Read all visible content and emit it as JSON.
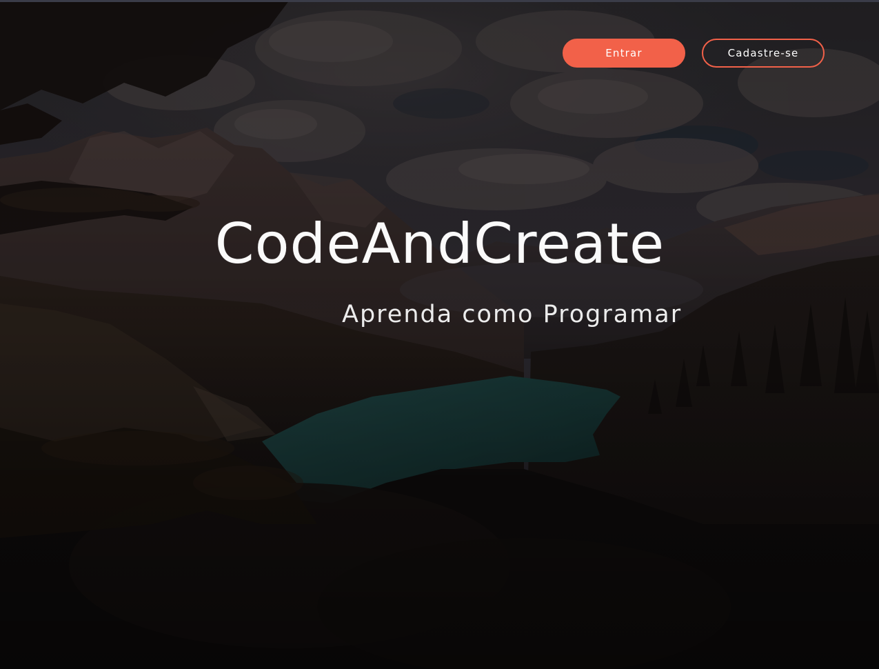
{
  "header": {
    "login_label": "Entrar",
    "signup_label": "Cadastre-se"
  },
  "hero": {
    "title": "CodeAndCreate",
    "subtitle": "Aprenda como Programar"
  },
  "colors": {
    "accent": "#f26149",
    "text": "#ffffff",
    "overlay": "#141213"
  }
}
